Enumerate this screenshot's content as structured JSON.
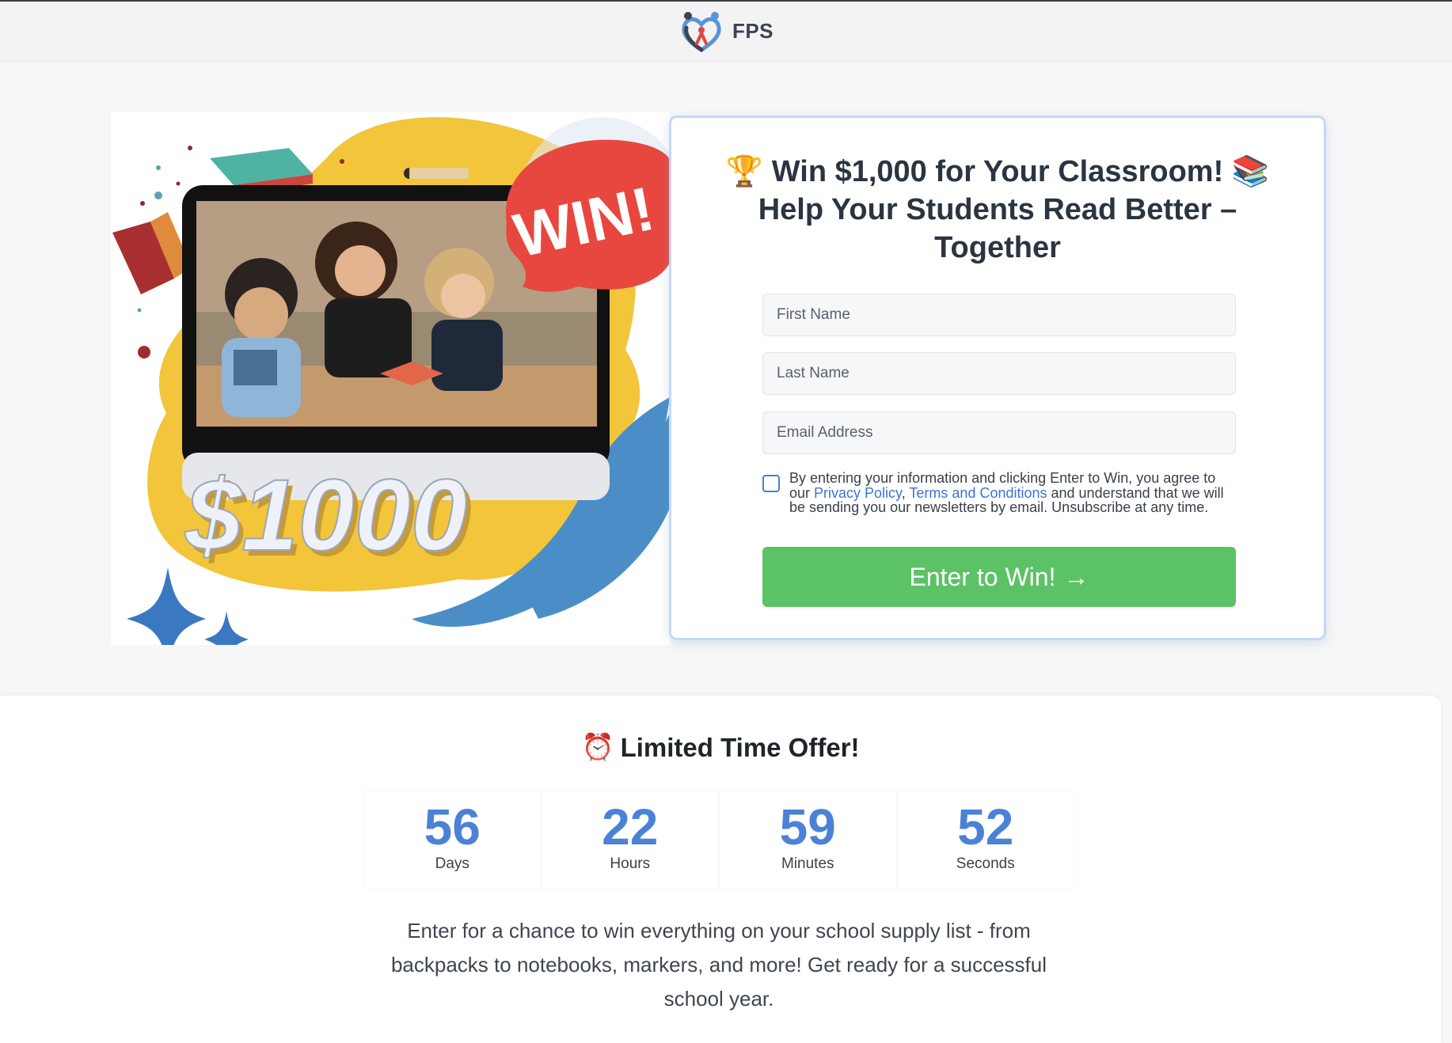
{
  "header": {
    "logo_text": "FPS"
  },
  "form": {
    "title": "Win $1,000 for Your Classroom!",
    "title_line2": "Help Your Students Read Better – Together",
    "title_icon_left": "trophy-emoji",
    "title_icon_right": "books-emoji",
    "first_name_placeholder": "First Name",
    "last_name_placeholder": "Last Name",
    "email_placeholder": "Email Address",
    "consent_prefix": "By entering your information and clicking Enter to Win, you agree to our ",
    "privacy_link": "Privacy Policy",
    "comma": ", ",
    "terms_link": "Terms and Conditions",
    "consent_suffix": " and understand that we will be sending you our newsletters by email. Unsubscribe at any time.",
    "submit_label": "Enter to Win!",
    "submit_icon": "arrow-right-icon"
  },
  "hero": {
    "badge_text": "WIN!",
    "prize_text": "$1000"
  },
  "offer": {
    "title": "Limited Time Offer!",
    "title_icon": "alarm-clock-emoji",
    "timer": [
      {
        "value": "56",
        "label": "Days"
      },
      {
        "value": "22",
        "label": "Hours"
      },
      {
        "value": "59",
        "label": "Minutes"
      },
      {
        "value": "52",
        "label": "Seconds"
      }
    ],
    "description": "Enter for a chance to win everything on your school supply list - from backpacks to notebooks, markers, and more! Get ready for a successful school year."
  },
  "colors": {
    "accent_blue": "#4c82d6",
    "cta_green": "#5cc266",
    "link_blue": "#3b73d6",
    "badge_red": "#e8473f",
    "blob_yellow": "#f2c53a",
    "blob_blue": "#4b8ec7"
  }
}
